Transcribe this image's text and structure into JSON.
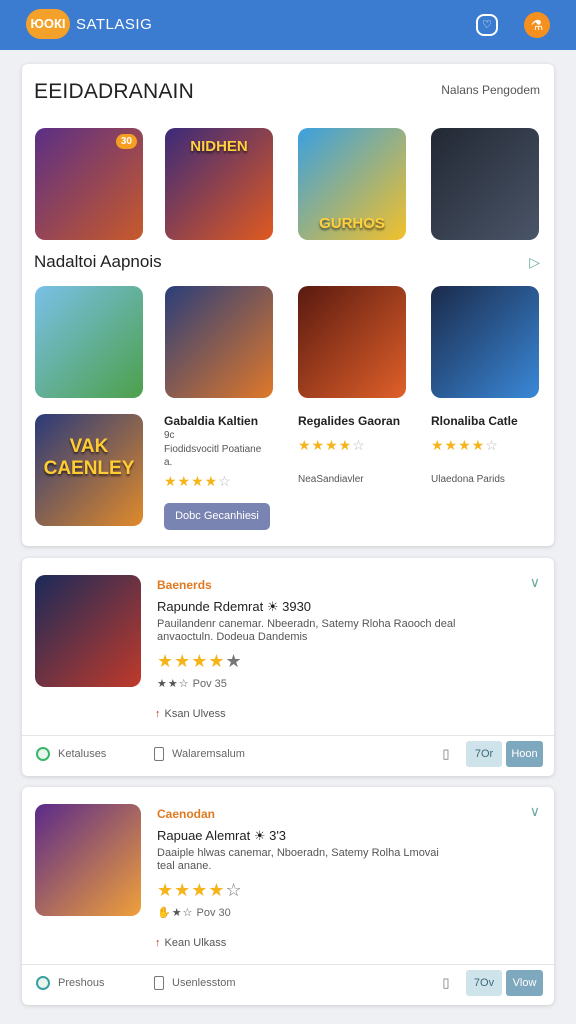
{
  "header": {
    "logo_text": "ЮОКІ",
    "app_name": "SATLASIG",
    "bell_icon": "bell-icon",
    "user_icon": "user-icon"
  },
  "featured": {
    "title": "EEIDADRANAIN",
    "link": "Nalans Pengodem",
    "sub_title": "Nadaltoi Aapnois",
    "row1": [
      {
        "label": "",
        "badge": "30",
        "colors": [
          "#5b2f86",
          "#c85a2a"
        ]
      },
      {
        "label": "NIDHEN",
        "badge": "",
        "colors": [
          "#3a2a7a",
          "#e05a20"
        ]
      },
      {
        "label": "GURHOS",
        "badge": "",
        "colors": [
          "#3aa0e0",
          "#f2c02a"
        ]
      },
      {
        "label": "",
        "badge": "",
        "colors": [
          "#222833",
          "#4a5568"
        ]
      }
    ],
    "row2": [
      {
        "label": "",
        "badge": "",
        "colors": [
          "#7ac0e8",
          "#4ca04a"
        ]
      },
      {
        "label": "",
        "badge": "",
        "colors": [
          "#2a3e7a",
          "#e0782a"
        ]
      },
      {
        "label": "",
        "badge": "",
        "colors": [
          "#5a1a10",
          "#e0602a"
        ]
      },
      {
        "label": "",
        "badge": "",
        "colors": [
          "#1a2a4a",
          "#3a88d8"
        ]
      }
    ],
    "row3_tile": {
      "label": "VAK CAENLEY",
      "badge": "",
      "colors": [
        "#2a3a7a",
        "#e08a2a"
      ]
    },
    "games": [
      {
        "name": "Gabaldia Kaltien",
        "sub": "9c",
        "desc": "Fiodidsvocitl Poatiane",
        "desc2": "a.",
        "rating": 4
      },
      {
        "name": "Regalides Gaoran",
        "sub": "",
        "desc": "NeaSandiavler",
        "desc2": "",
        "rating": 4
      },
      {
        "name": "Rlonaliba Catle",
        "sub": "",
        "desc": "Ulaedona Parids",
        "desc2": "",
        "rating": 4
      }
    ],
    "button": "Dobc Gecanhiesi"
  },
  "list": [
    {
      "category": "Baenerds",
      "title": "Rapunde Rdemrat ☀ 3930",
      "desc": "Pauilandenr canemar. Nbeeradn, Satemy Rloha Raooch deal anvaoctuln. Dodeua Dandemis",
      "rating": 4,
      "small_rating": "Pov 35",
      "status": "Ksan Ulvess",
      "foot_left": "Ketaluses",
      "foot_mid": "Walaremsalum",
      "btn_secondary": "7Or",
      "btn_primary": "Hoon",
      "thumb_colors": [
        "#1a2a5a",
        "#c03a2a"
      ]
    },
    {
      "category": "Caenodan",
      "title": "Rapuae Alemrat ☀ 3'3",
      "desc": "Daaiple hlwas canemar, Nboeradn, Satemy Rolha Lmovai teal anane.",
      "rating": 4,
      "small_rating": "Pov 30",
      "status": "Kean Ulkass",
      "foot_left": "Preshous",
      "foot_mid": "Usenlesstom",
      "btn_secondary": "7Ov",
      "btn_primary": "Vlow",
      "thumb_colors": [
        "#5a2a8a",
        "#f0a03a"
      ]
    }
  ]
}
